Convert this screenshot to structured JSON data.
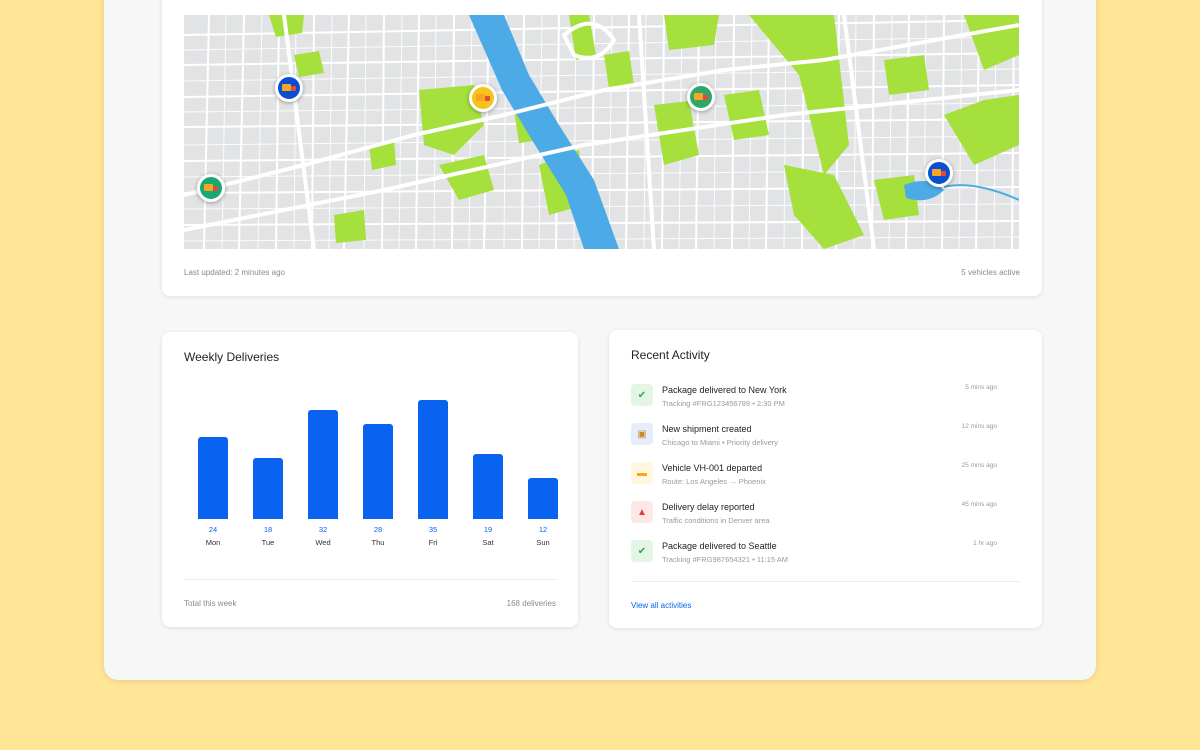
{
  "map_section": {
    "last_updated": "Last updated: 2 minutes ago",
    "vehicles_active": "5 vehicles active"
  },
  "weekly": {
    "title": "Weekly Deliveries",
    "footer_left": "Total this week",
    "footer_right": "168 deliveries",
    "values_labels": [
      "24",
      "18",
      "32",
      "28",
      "35",
      "19",
      "12"
    ]
  },
  "chart_data": {
    "type": "bar",
    "categories": [
      "Mon",
      "Tue",
      "Wed",
      "Thu",
      "Fri",
      "Sat",
      "Sun"
    ],
    "values": [
      24,
      18,
      32,
      28,
      35,
      19,
      12
    ],
    "title": "Weekly Deliveries",
    "xlabel": "",
    "ylabel": "",
    "color": "#0a62f0"
  },
  "activity": {
    "title": "Recent Activity",
    "view_all": "View all activities",
    "items": [
      {
        "title": "Package delivered to New York",
        "subtitle": "Tracking #FRG123456789 • 2:30 PM",
        "time": "5 mins ago",
        "icon": "check-icon",
        "bg": "#e3f6e6",
        "fg": "#2ea84a"
      },
      {
        "title": "New shipment created",
        "subtitle": "Chicago to Miami • Priority delivery",
        "time": "12 mins ago",
        "icon": "package-icon",
        "bg": "#e6eefc",
        "fg": "#c98a2b"
      },
      {
        "title": "Vehicle VH-001 departed",
        "subtitle": "Route: Los Angeles → Phoenix",
        "time": "25 mins ago",
        "icon": "truck-icon",
        "bg": "#fff8df",
        "fg": "#f6a623"
      },
      {
        "title": "Delivery delay reported",
        "subtitle": "Traffic conditions in Denver area",
        "time": "45 mins ago",
        "icon": "warning-icon",
        "bg": "#fde7e7",
        "fg": "#e0403a"
      },
      {
        "title": "Package delivered to Seattle",
        "subtitle": "Tracking #FRG987654321 • 11:15 AM",
        "time": "1 hr ago",
        "icon": "check-icon",
        "bg": "#e3f6e6",
        "fg": "#2ea84a"
      }
    ]
  },
  "map_pins": [
    {
      "name": "vehicle-pin-blue",
      "color": "#0a4fd0"
    },
    {
      "name": "vehicle-pin-yellow",
      "color": "#f8c21a"
    },
    {
      "name": "vehicle-pin-green",
      "color": "#2fa76a"
    },
    {
      "name": "vehicle-pin-green",
      "color": "#1aa774"
    },
    {
      "name": "vehicle-pin-blue",
      "color": "#0a4fd0"
    }
  ]
}
